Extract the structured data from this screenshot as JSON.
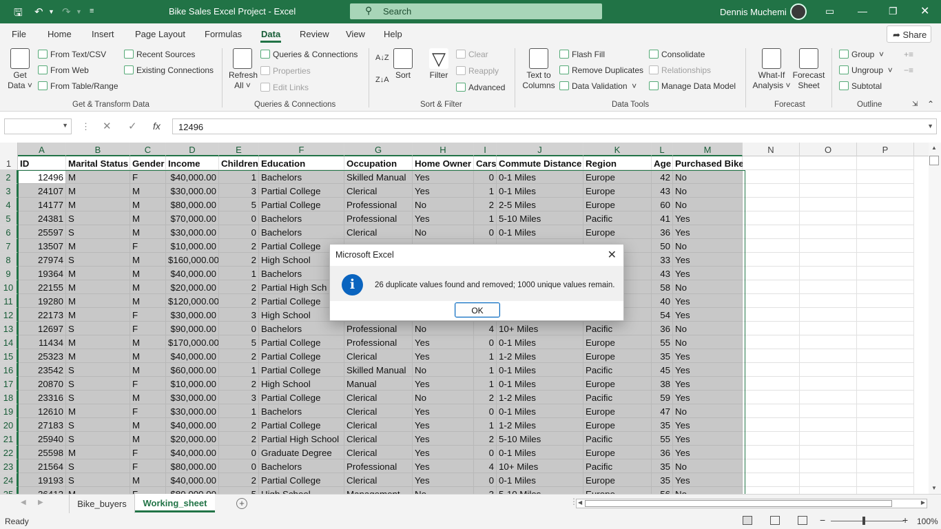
{
  "titlebar": {
    "doc_title": "Bike Sales Excel Project  -  Excel",
    "search_placeholder": "Search",
    "user_name": "Dennis Muchemi"
  },
  "menu": [
    "File",
    "Home",
    "Insert",
    "Page Layout",
    "Formulas",
    "Data",
    "Review",
    "View",
    "Help"
  ],
  "active_menu": "Data",
  "share_label": "Share",
  "ribbon": {
    "get_data": "Get Data",
    "from_text": "From Text/CSV",
    "from_web": "From Web",
    "from_table": "From Table/Range",
    "recent_sources": "Recent Sources",
    "existing_connections": "Existing Connections",
    "group_get_transform": "Get & Transform Data",
    "refresh_all": "Refresh All",
    "queries_connections": "Queries & Connections",
    "properties": "Properties",
    "edit_links": "Edit Links",
    "group_queries": "Queries & Connections",
    "sort": "Sort",
    "filter": "Filter",
    "clear": "Clear",
    "reapply": "Reapply",
    "advanced": "Advanced",
    "group_sort_filter": "Sort & Filter",
    "text_to_columns": "Text to Columns",
    "flash_fill": "Flash Fill",
    "remove_duplicates": "Remove Duplicates",
    "data_validation": "Data Validation",
    "consolidate": "Consolidate",
    "relationships": "Relationships",
    "manage_data_model": "Manage Data Model",
    "group_data_tools": "Data Tools",
    "what_if": "What-If Analysis",
    "forecast_sheet": "Forecast Sheet",
    "group_forecast": "Forecast",
    "group_btn": "Group",
    "ungroup": "Ungroup",
    "subtotal": "Subtotal",
    "group_outline": "Outline"
  },
  "formula_bar": {
    "name_box": "",
    "formula": "12496"
  },
  "grid": {
    "columns": [
      "A",
      "B",
      "C",
      "D",
      "E",
      "F",
      "G",
      "H",
      "I",
      "J",
      "K",
      "L",
      "M",
      "N",
      "O",
      "P"
    ],
    "header": [
      "ID",
      "Marital Status",
      "Gender",
      "Income",
      "Children",
      "Education",
      "Occupation",
      "Home Owner",
      "Cars",
      "Commute Distance",
      "Region",
      "Age",
      "Purchased Bike"
    ],
    "rows": [
      [
        "12496",
        "M",
        "F",
        "$40,000.00",
        "1",
        "Bachelors",
        "Skilled Manual",
        "Yes",
        "0",
        "0-1 Miles",
        "Europe",
        "42",
        "No"
      ],
      [
        "24107",
        "M",
        "M",
        "$30,000.00",
        "3",
        "Partial College",
        "Clerical",
        "Yes",
        "1",
        "0-1 Miles",
        "Europe",
        "43",
        "No"
      ],
      [
        "14177",
        "M",
        "M",
        "$80,000.00",
        "5",
        "Partial College",
        "Professional",
        "No",
        "2",
        "2-5 Miles",
        "Europe",
        "60",
        "No"
      ],
      [
        "24381",
        "S",
        "M",
        "$70,000.00",
        "0",
        "Bachelors",
        "Professional",
        "Yes",
        "1",
        "5-10 Miles",
        "Pacific",
        "41",
        "Yes"
      ],
      [
        "25597",
        "S",
        "M",
        "$30,000.00",
        "0",
        "Bachelors",
        "Clerical",
        "No",
        "0",
        "0-1 Miles",
        "Europe",
        "36",
        "Yes"
      ],
      [
        "13507",
        "M",
        "F",
        "$10,000.00",
        "2",
        "Partial College",
        "",
        "",
        "",
        "",
        "",
        "50",
        "No"
      ],
      [
        "27974",
        "S",
        "M",
        "$160,000.00",
        "2",
        "High School",
        "",
        "",
        "",
        "",
        "",
        "33",
        "Yes"
      ],
      [
        "19364",
        "M",
        "M",
        "$40,000.00",
        "1",
        "Bachelors",
        "",
        "",
        "",
        "",
        "",
        "43",
        "Yes"
      ],
      [
        "22155",
        "M",
        "M",
        "$20,000.00",
        "2",
        "Partial High Sch",
        "",
        "",
        "",
        "",
        "",
        "58",
        "No"
      ],
      [
        "19280",
        "M",
        "M",
        "$120,000.00",
        "2",
        "Partial College",
        "",
        "",
        "",
        "",
        "",
        "40",
        "Yes"
      ],
      [
        "22173",
        "M",
        "F",
        "$30,000.00",
        "3",
        "High School",
        "",
        "",
        "",
        "",
        "",
        "54",
        "Yes"
      ],
      [
        "12697",
        "S",
        "F",
        "$90,000.00",
        "0",
        "Bachelors",
        "Professional",
        "No",
        "4",
        "10+ Miles",
        "Pacific",
        "36",
        "No"
      ],
      [
        "11434",
        "M",
        "M",
        "$170,000.00",
        "5",
        "Partial College",
        "Professional",
        "Yes",
        "0",
        "0-1 Miles",
        "Europe",
        "55",
        "No"
      ],
      [
        "25323",
        "M",
        "M",
        "$40,000.00",
        "2",
        "Partial College",
        "Clerical",
        "Yes",
        "1",
        "1-2 Miles",
        "Europe",
        "35",
        "Yes"
      ],
      [
        "23542",
        "S",
        "M",
        "$60,000.00",
        "1",
        "Partial College",
        "Skilled Manual",
        "No",
        "1",
        "0-1 Miles",
        "Pacific",
        "45",
        "Yes"
      ],
      [
        "20870",
        "S",
        "F",
        "$10,000.00",
        "2",
        "High School",
        "Manual",
        "Yes",
        "1",
        "0-1 Miles",
        "Europe",
        "38",
        "Yes"
      ],
      [
        "23316",
        "S",
        "M",
        "$30,000.00",
        "3",
        "Partial College",
        "Clerical",
        "No",
        "2",
        "1-2 Miles",
        "Pacific",
        "59",
        "Yes"
      ],
      [
        "12610",
        "M",
        "F",
        "$30,000.00",
        "1",
        "Bachelors",
        "Clerical",
        "Yes",
        "0",
        "0-1 Miles",
        "Europe",
        "47",
        "No"
      ],
      [
        "27183",
        "S",
        "M",
        "$40,000.00",
        "2",
        "Partial College",
        "Clerical",
        "Yes",
        "1",
        "1-2 Miles",
        "Europe",
        "35",
        "Yes"
      ],
      [
        "25940",
        "S",
        "M",
        "$20,000.00",
        "2",
        "Partial High School",
        "Clerical",
        "Yes",
        "2",
        "5-10 Miles",
        "Pacific",
        "55",
        "Yes"
      ],
      [
        "25598",
        "M",
        "F",
        "$40,000.00",
        "0",
        "Graduate Degree",
        "Clerical",
        "Yes",
        "0",
        "0-1 Miles",
        "Europe",
        "36",
        "Yes"
      ],
      [
        "21564",
        "S",
        "F",
        "$80,000.00",
        "0",
        "Bachelors",
        "Professional",
        "Yes",
        "4",
        "10+ Miles",
        "Pacific",
        "35",
        "No"
      ],
      [
        "19193",
        "S",
        "M",
        "$40,000.00",
        "2",
        "Partial College",
        "Clerical",
        "Yes",
        "0",
        "0-1 Miles",
        "Europe",
        "35",
        "Yes"
      ],
      [
        "26412",
        "M",
        "F",
        "$80,000.00",
        "5",
        "High School",
        "Management",
        "No",
        "3",
        "5-10 Miles",
        "Europe",
        "56",
        "No"
      ]
    ]
  },
  "sheets": [
    "Bike_buyers",
    "Working_sheet"
  ],
  "active_sheet": "Working_sheet",
  "status": {
    "text": "Ready",
    "zoom": "100%"
  },
  "dialog": {
    "title": "Microsoft Excel",
    "message": "26 duplicate values found and removed; 1000 unique values remain.",
    "ok_label": "OK"
  }
}
